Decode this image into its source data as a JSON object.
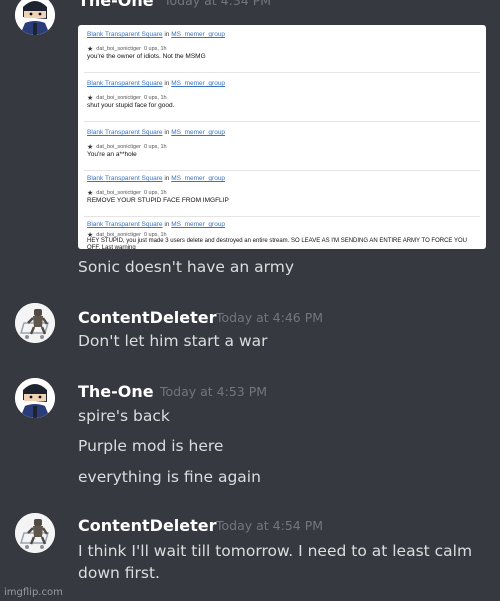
{
  "messages": [
    {
      "username": "The-One",
      "timestamp": "Today at 4:34 PM",
      "embed": [
        {
          "group_link": "Blank Transparent Square",
          "in": "in",
          "group": "MS_memer_group",
          "user": "dat_boi_sonictiger",
          "meta": "0 ups, 1h",
          "body": "you're the owner of idiots. Not the MSMG"
        },
        {
          "group_link": "Blank Transparent Square",
          "in": "in",
          "group": "MS_memer_group",
          "user": "dat_boi_sonictiger",
          "meta": "0 ups, 1h",
          "body": "shut your stupid face for good."
        },
        {
          "group_link": "Blank Transparent Square",
          "in": "in",
          "group": "MS_memer_group",
          "user": "dat_boi_sonictiger",
          "meta": "0 ups, 1h",
          "body": "You're an a**hole"
        },
        {
          "group_link": "Blank Transparent Square",
          "in": "in",
          "group": "MS_memer_group",
          "user": "dat_boi_sonictiger",
          "meta": "0 ups, 1h",
          "body": "REMOVE YOUR STUPID FACE FROM IMGFLIP"
        },
        {
          "group_link": "Blank Transparent Square",
          "in": "in",
          "group": "MS_memer_group",
          "user": "dat_boi_sonictiger",
          "meta": "0 ups, 1h",
          "body": "HEY STUPID, you just made 3 users delete and destroyed an entire stream. SO LEAVE AS I'M SENDING AN ENTIRE ARMY TO FORCE YOU OFF. Last warning"
        }
      ],
      "lines": [
        "Sonic doesn't have an army"
      ]
    },
    {
      "username": "ContentDeleter",
      "timestamp": "Today at 4:46 PM",
      "lines": [
        "Don't let him start a war"
      ]
    },
    {
      "username": "The-One",
      "timestamp": "Today at 4:53 PM",
      "lines": [
        "spire's back",
        "Purple mod is here",
        "everything is fine again"
      ]
    },
    {
      "username": "ContentDeleter",
      "timestamp": "Today at 4:54 PM",
      "lines": [
        "I think I'll wait till tomorrow. I need to at least calm down first."
      ]
    }
  ],
  "watermark": "imgflip.com",
  "colors": {
    "background": "#36393f",
    "username": "#ffffff",
    "timestamp": "#72767d",
    "text": "#dcddde",
    "link": "#3a73c4"
  },
  "icons": [
    "avatar-ninja-icon",
    "avatar-robot-cart-icon",
    "star-icon"
  ]
}
